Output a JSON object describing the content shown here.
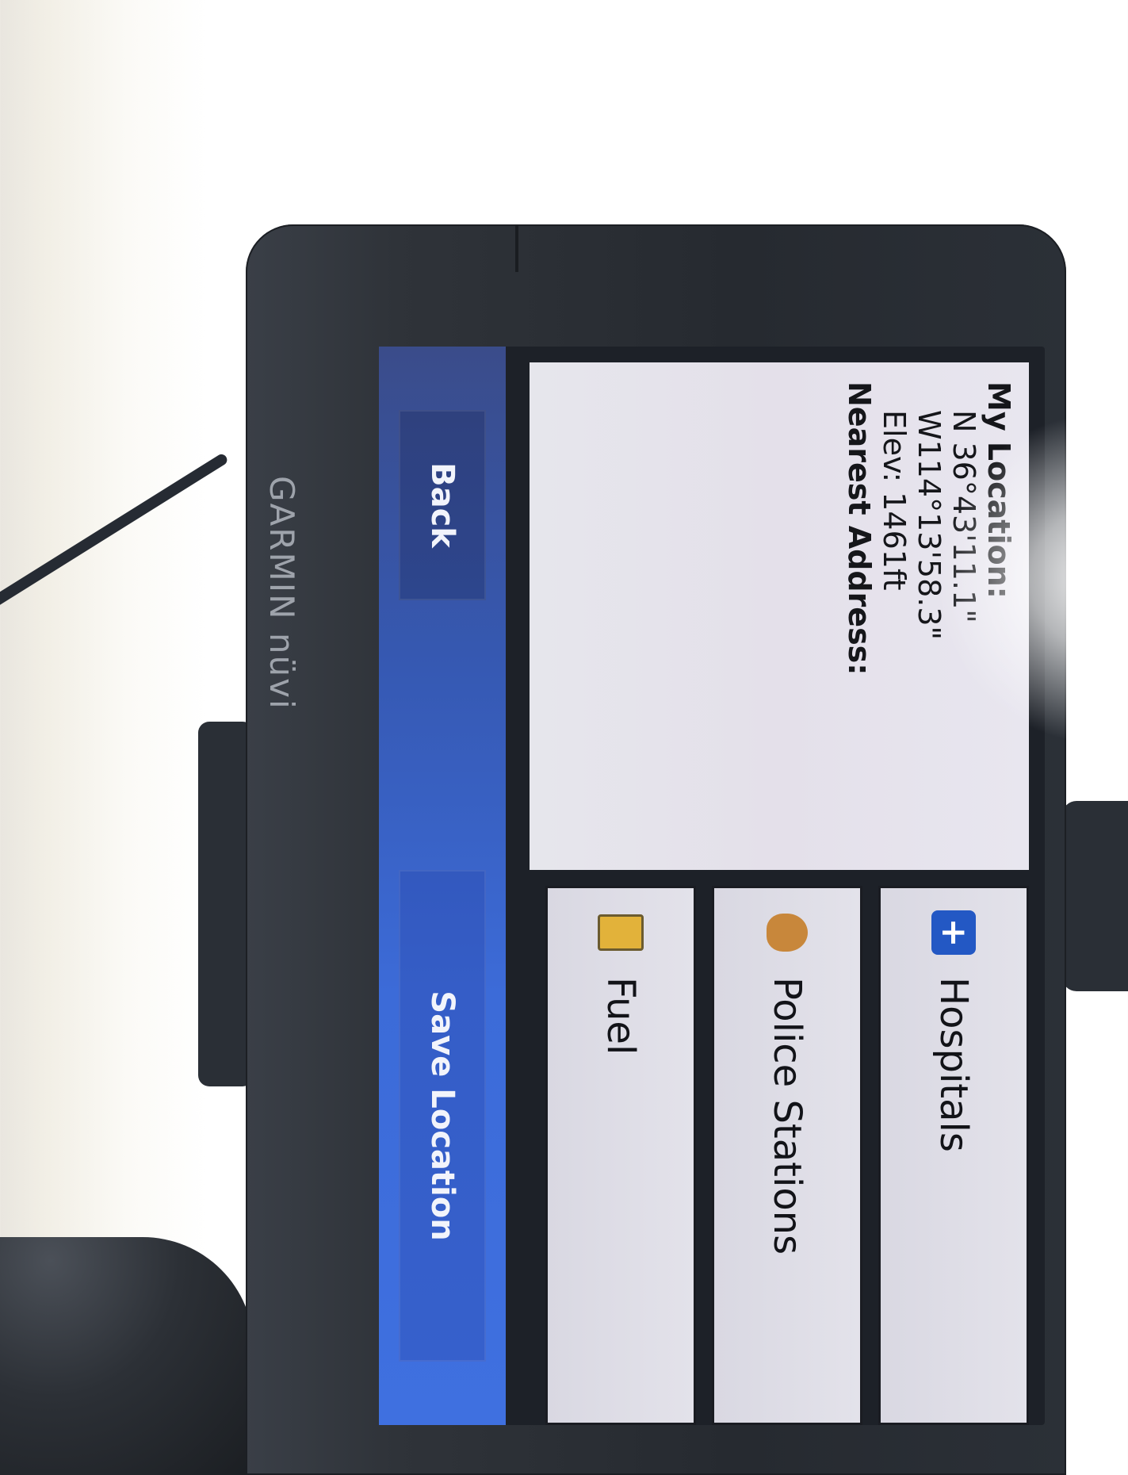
{
  "device": {
    "brand_text": "GARMIN nüvi"
  },
  "location_panel": {
    "heading": "My Location:",
    "latitude": "N 36°43'11.1\"",
    "longitude": "W114°13'58.3\"",
    "elevation": "Elev: 1461ft",
    "address_heading": "Nearest Address:"
  },
  "poi_list": [
    {
      "label": "Hospitals",
      "icon": "hospital-cross-icon"
    },
    {
      "label": "Police Stations",
      "icon": "police-badge-icon"
    },
    {
      "label": "Fuel",
      "icon": "fuel-pump-icon"
    }
  ],
  "bottom_bar": {
    "back_label": "Back",
    "save_label": "Save Location"
  },
  "colors": {
    "bottom_bar_blue": "#3659b3",
    "hospital_icon_blue": "#2358c4",
    "screen_panel": "#e6e4ec"
  }
}
